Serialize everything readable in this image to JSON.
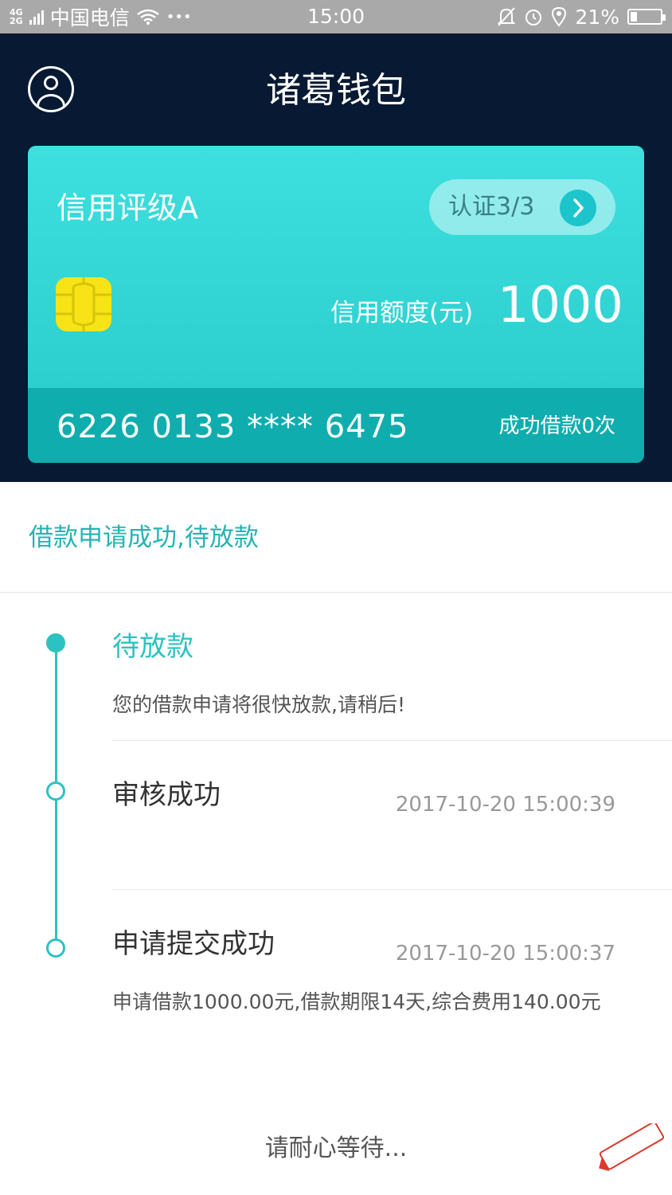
{
  "status_bar": {
    "network_top": "4G",
    "network_bottom": "2G",
    "carrier": "中国电信",
    "dots": "•••",
    "time": "15:00",
    "battery": "21%"
  },
  "header": {
    "title": "诸葛钱包"
  },
  "card": {
    "rating": "信用评级A",
    "cert_label": "认证3/3",
    "limit_label": "信用额度(元)",
    "limit_value": "1000",
    "card_number": "6226 0133 **** 6475",
    "loan_count": "成功借款0次"
  },
  "banner": {
    "text": "借款申请成功,待放款"
  },
  "timeline": {
    "steps": [
      {
        "title": "待放款",
        "description": "您的借款申请将很快放款,请稍后!",
        "time": ""
      },
      {
        "title": "审核成功",
        "description": "",
        "time": "2017-10-20 15:00:39"
      },
      {
        "title": "申请提交成功",
        "description": "申请借款1000.00元,借款期限14天,综合费用140.00元",
        "time": "2017-10-20 15:00:37"
      }
    ]
  },
  "footer": {
    "wait_text": "请耐心等待..."
  },
  "colors": {
    "accent": "#2cc2c2",
    "header_bg": "#071933",
    "card_start": "#3de0df",
    "card_footer": "#10adae",
    "chip": "#f7e316"
  }
}
